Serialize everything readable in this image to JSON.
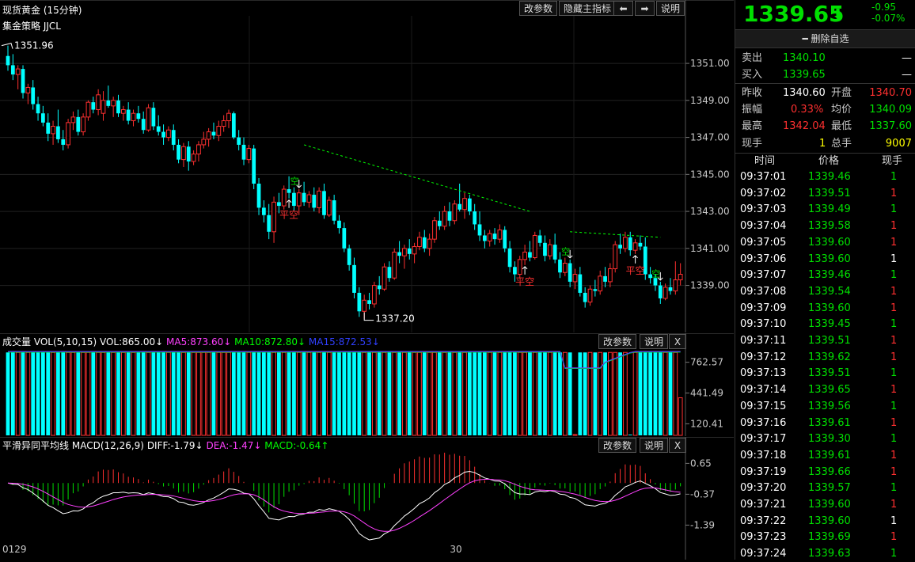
{
  "header": {
    "title": "现货黄金 (15分钟)",
    "buttons": [
      "改参数",
      "隐藏主指标",
      "⬅",
      "➡",
      "说明"
    ]
  },
  "strategy_label": "集金策略 JJCL",
  "chart_data": [
    {
      "type": "candlestick",
      "title": "现货黄金 (15分钟)",
      "y_ticks": [
        "1351.00",
        "1349.00",
        "1347.00",
        "1345.00",
        "1343.00",
        "1341.00",
        "1339.00"
      ],
      "ylim": [
        1336.8,
        1352.8
      ],
      "x_labels": [
        {
          "index": 0,
          "text": "0129"
        },
        {
          "index": 89,
          "text": "30"
        }
      ],
      "annotations": {
        "high_label": "1351.96",
        "low_label": "1337.20"
      },
      "signals": [
        {
          "i": 58,
          "kind": "空"
        },
        {
          "i": 56,
          "kind": "平空"
        },
        {
          "i": 112,
          "kind": "空"
        },
        {
          "i": 103,
          "kind": "平空"
        },
        {
          "i": 130,
          "kind": "空"
        },
        {
          "i": 125,
          "kind": "平空"
        }
      ],
      "candles": [
        [
          1351.4,
          1351.96,
          1350.6,
          1350.9
        ],
        [
          1350.9,
          1351.5,
          1350.1,
          1350.4
        ],
        [
          1350.4,
          1350.9,
          1349.6,
          1350.7
        ],
        [
          1350.7,
          1350.9,
          1349.1,
          1349.4
        ],
        [
          1349.4,
          1349.9,
          1348.8,
          1349.7
        ],
        [
          1349.7,
          1350.1,
          1348.5,
          1348.8
        ],
        [
          1348.8,
          1349.2,
          1347.9,
          1348.3
        ],
        [
          1348.3,
          1348.7,
          1347.6,
          1347.8
        ],
        [
          1347.8,
          1348.3,
          1346.8,
          1347.2
        ],
        [
          1347.2,
          1347.9,
          1346.6,
          1347.6
        ],
        [
          1347.6,
          1348.5,
          1346.7,
          1346.9
        ],
        [
          1346.9,
          1347.4,
          1346.3,
          1346.6
        ],
        [
          1346.6,
          1348.0,
          1346.4,
          1347.8
        ],
        [
          1347.8,
          1348.4,
          1347.4,
          1348.1
        ],
        [
          1348.1,
          1348.5,
          1347.1,
          1347.3
        ],
        [
          1347.3,
          1348.3,
          1347.1,
          1348.1
        ],
        [
          1348.1,
          1349.0,
          1347.9,
          1348.9
        ],
        [
          1348.9,
          1349.2,
          1348.3,
          1348.5
        ],
        [
          1348.5,
          1349.6,
          1348.2,
          1349.3
        ],
        [
          1348.3,
          1349.5,
          1347.9,
          1349.0
        ],
        [
          1349.0,
          1349.8,
          1348.6,
          1348.7
        ],
        [
          1348.7,
          1349.2,
          1348.1,
          1349.0
        ],
        [
          1349.0,
          1349.3,
          1348.1,
          1348.3
        ],
        [
          1348.3,
          1348.7,
          1347.9,
          1348.5
        ],
        [
          1348.5,
          1348.9,
          1347.7,
          1347.9
        ],
        [
          1347.9,
          1348.5,
          1347.6,
          1348.3
        ],
        [
          1348.3,
          1348.7,
          1347.8,
          1348.0
        ],
        [
          1348.0,
          1348.4,
          1347.2,
          1347.4
        ],
        [
          1347.4,
          1348.8,
          1347.3,
          1348.6
        ],
        [
          1348.6,
          1348.9,
          1347.4,
          1347.6
        ],
        [
          1347.6,
          1348.2,
          1347.1,
          1347.3
        ],
        [
          1347.3,
          1347.7,
          1346.6,
          1347.0
        ],
        [
          1347.0,
          1347.6,
          1346.8,
          1347.4
        ],
        [
          1347.4,
          1347.7,
          1346.3,
          1346.6
        ],
        [
          1346.6,
          1346.9,
          1345.6,
          1345.8
        ],
        [
          1345.8,
          1346.7,
          1345.4,
          1346.5
        ],
        [
          1346.5,
          1346.8,
          1345.2,
          1345.7
        ],
        [
          1345.7,
          1346.3,
          1345.5,
          1346.1
        ],
        [
          1346.1,
          1346.8,
          1345.7,
          1346.6
        ],
        [
          1346.6,
          1347.3,
          1346.4,
          1346.9
        ],
        [
          1346.9,
          1347.5,
          1346.5,
          1347.3
        ],
        [
          1347.3,
          1347.8,
          1346.9,
          1347.1
        ],
        [
          1347.1,
          1347.9,
          1346.8,
          1347.6
        ],
        [
          1347.6,
          1348.2,
          1347.3,
          1347.9
        ],
        [
          1347.9,
          1348.5,
          1347.5,
          1348.3
        ],
        [
          1348.3,
          1348.4,
          1346.9,
          1347.0
        ],
        [
          1347.0,
          1347.4,
          1346.3,
          1346.6
        ],
        [
          1346.6,
          1347.0,
          1345.5,
          1345.8
        ],
        [
          1345.8,
          1346.6,
          1345.6,
          1346.4
        ],
        [
          1346.4,
          1346.6,
          1344.2,
          1344.5
        ],
        [
          1344.5,
          1344.8,
          1342.8,
          1343.2
        ],
        [
          1343.2,
          1343.6,
          1342.4,
          1342.8
        ],
        [
          1342.8,
          1343.4,
          1341.5,
          1341.9
        ],
        [
          1341.9,
          1343.8,
          1341.3,
          1343.5
        ],
        [
          1343.5,
          1344.0,
          1342.9,
          1343.3
        ],
        [
          1343.3,
          1344.4,
          1343.1,
          1344.2
        ],
        [
          1344.2,
          1344.9,
          1343.7,
          1344.0
        ],
        [
          1344.0,
          1344.3,
          1343.0,
          1343.3
        ],
        [
          1343.3,
          1344.2,
          1342.8,
          1344.0
        ],
        [
          1344.0,
          1344.6,
          1343.3,
          1343.5
        ],
        [
          1343.5,
          1344.1,
          1343.2,
          1343.9
        ],
        [
          1343.9,
          1344.3,
          1343.0,
          1343.2
        ],
        [
          1343.2,
          1344.3,
          1342.9,
          1344.1
        ],
        [
          1344.1,
          1344.5,
          1342.6,
          1342.8
        ],
        [
          1342.8,
          1343.8,
          1342.7,
          1343.6
        ],
        [
          1343.6,
          1343.9,
          1342.3,
          1342.5
        ],
        [
          1342.5,
          1342.8,
          1341.8,
          1342.1
        ],
        [
          1342.1,
          1342.4,
          1340.8,
          1341.0
        ],
        [
          1341.0,
          1341.2,
          1339.8,
          1340.1
        ],
        [
          1340.1,
          1340.5,
          1338.3,
          1338.6
        ],
        [
          1338.6,
          1338.9,
          1337.3,
          1337.6
        ],
        [
          1337.6,
          1338.5,
          1337.2,
          1338.2
        ],
        [
          1338.2,
          1338.6,
          1337.7,
          1338.0
        ],
        [
          1338.0,
          1339.2,
          1337.8,
          1339.0
        ],
        [
          1339.0,
          1339.5,
          1338.5,
          1338.8
        ],
        [
          1338.8,
          1340.2,
          1338.7,
          1340.0
        ],
        [
          1340.0,
          1340.3,
          1339.2,
          1339.4
        ],
        [
          1339.4,
          1341.0,
          1339.3,
          1340.8
        ],
        [
          1340.8,
          1341.4,
          1340.2,
          1340.6
        ],
        [
          1340.6,
          1341.2,
          1339.9,
          1341.0
        ],
        [
          1341.0,
          1341.5,
          1340.4,
          1340.7
        ],
        [
          1340.7,
          1341.3,
          1340.2,
          1341.1
        ],
        [
          1341.1,
          1341.9,
          1340.9,
          1341.6
        ],
        [
          1341.6,
          1342.0,
          1340.8,
          1341.0
        ],
        [
          1341.0,
          1341.8,
          1340.6,
          1341.5
        ],
        [
          1341.5,
          1342.7,
          1341.3,
          1342.5
        ],
        [
          1342.5,
          1343.0,
          1342.0,
          1342.2
        ],
        [
          1342.2,
          1343.3,
          1342.0,
          1343.0
        ],
        [
          1343.0,
          1343.5,
          1342.2,
          1342.5
        ],
        [
          1342.5,
          1343.6,
          1342.3,
          1343.4
        ],
        [
          1343.4,
          1344.5,
          1343.0,
          1343.1
        ],
        [
          1343.1,
          1344.0,
          1342.6,
          1343.7
        ],
        [
          1343.7,
          1343.9,
          1342.8,
          1343.0
        ],
        [
          1343.0,
          1343.4,
          1342.0,
          1342.3
        ],
        [
          1342.3,
          1343.0,
          1341.4,
          1341.7
        ],
        [
          1341.7,
          1342.0,
          1341.0,
          1341.4
        ],
        [
          1341.4,
          1342.0,
          1341.1,
          1341.8
        ],
        [
          1341.8,
          1342.1,
          1341.2,
          1341.5
        ],
        [
          1341.5,
          1342.3,
          1341.3,
          1342.0
        ],
        [
          1342.0,
          1342.2,
          1340.8,
          1341.0
        ],
        [
          1341.0,
          1341.4,
          1339.7,
          1340.0
        ],
        [
          1340.0,
          1340.3,
          1339.2,
          1339.6
        ],
        [
          1339.6,
          1340.6,
          1339.4,
          1340.4
        ],
        [
          1340.4,
          1341.2,
          1340.1,
          1340.8
        ],
        [
          1340.8,
          1341.4,
          1340.3,
          1340.5
        ],
        [
          1340.5,
          1341.9,
          1340.4,
          1341.7
        ],
        [
          1341.7,
          1342.0,
          1341.1,
          1341.3
        ],
        [
          1341.3,
          1341.7,
          1340.3,
          1340.6
        ],
        [
          1340.6,
          1341.5,
          1340.4,
          1341.2
        ],
        [
          1341.2,
          1341.8,
          1340.2,
          1340.4
        ],
        [
          1340.4,
          1340.8,
          1339.4,
          1339.7
        ],
        [
          1339.7,
          1340.5,
          1339.5,
          1340.2
        ],
        [
          1340.2,
          1340.4,
          1338.9,
          1339.2
        ],
        [
          1339.2,
          1339.9,
          1338.8,
          1339.6
        ],
        [
          1339.6,
          1340.0,
          1338.4,
          1338.6
        ],
        [
          1338.6,
          1338.9,
          1337.8,
          1338.1
        ],
        [
          1338.1,
          1339.0,
          1337.9,
          1338.8
        ],
        [
          1338.8,
          1339.3,
          1338.4,
          1338.7
        ],
        [
          1338.7,
          1339.8,
          1338.5,
          1339.5
        ],
        [
          1339.5,
          1340.0,
          1338.9,
          1339.2
        ],
        [
          1339.2,
          1340.2,
          1338.9,
          1339.9
        ],
        [
          1339.9,
          1341.4,
          1339.7,
          1341.2
        ],
        [
          1341.2,
          1341.8,
          1340.7,
          1341.0
        ],
        [
          1341.0,
          1341.9,
          1340.8,
          1341.6
        ],
        [
          1341.6,
          1341.9,
          1340.6,
          1340.9
        ],
        [
          1340.9,
          1341.5,
          1340.7,
          1341.3
        ],
        [
          1341.3,
          1341.7,
          1340.9,
          1341.1
        ],
        [
          1341.1,
          1341.6,
          1339.3,
          1339.6
        ],
        [
          1339.6,
          1340.0,
          1339.1,
          1339.4
        ],
        [
          1339.4,
          1339.6,
          1338.7,
          1339.0
        ],
        [
          1339.0,
          1339.2,
          1338.0,
          1338.3
        ],
        [
          1338.3,
          1339.1,
          1338.2,
          1338.9
        ],
        [
          1338.9,
          1339.4,
          1338.5,
          1338.7
        ],
        [
          1338.7,
          1340.3,
          1338.5,
          1339.3
        ],
        [
          1339.3,
          1340.2,
          1339.0,
          1339.6
        ]
      ]
    },
    {
      "type": "bar",
      "title": "成交量",
      "indicator": "VOL(5,10,15)",
      "legend": [
        {
          "label": "VOL:865.00↓",
          "color": "#ffffff"
        },
        {
          "label": "MA5:873.60↓",
          "color": "#ff40ff"
        },
        {
          "label": "MA10:872.80↓",
          "color": "#00ff00"
        },
        {
          "label": "MA15:872.53↓",
          "color": "#3040ff"
        }
      ],
      "y_ticks": [
        "762.57",
        "441.49",
        "120.41"
      ],
      "ylim": [
        0,
        900
      ]
    },
    {
      "type": "macd",
      "title": "平滑异同平均线",
      "indicator": "MACD(12,26,9)",
      "legend": [
        {
          "label": "DIFF:-1.79↓",
          "color": "#ffffff"
        },
        {
          "label": "DEA:-1.47↓",
          "color": "#ff40ff"
        },
        {
          "label": "MACD:-0.64↑",
          "color": "#00ff00"
        }
      ],
      "y_ticks": [
        "0.65",
        "-0.37",
        "-1.39"
      ],
      "ylim": [
        -2.4,
        1.0
      ]
    }
  ],
  "volume_panel": {
    "buttons": [
      "改参数",
      "说明",
      "X"
    ]
  },
  "macd_panel": {
    "buttons": [
      "改参数",
      "说明",
      "X"
    ]
  },
  "quote": {
    "price": "1339.65",
    "arrow": "⬇",
    "change": "-0.95",
    "change_pct": "-0.07%",
    "delete_label": "━ 删除自选",
    "sell_label": "卖出",
    "sell_value": "1340.10",
    "sell_dash": "—",
    "buy_label": "买入",
    "buy_value": "1339.65",
    "buy_dash": "—",
    "prev_close_label": "昨收",
    "prev_close": "1340.60",
    "open_label": "开盘",
    "open": "1340.70",
    "amplitude_label": "振幅",
    "amplitude": "0.33%",
    "avg_label": "均价",
    "avg": "1340.09",
    "high_label": "最高",
    "high": "1342.04",
    "low_label": "最低",
    "low": "1337.60",
    "hand_label": "现手",
    "hand": "1",
    "total_label": "总手",
    "total": "9007"
  },
  "trades": {
    "headers": [
      "时间",
      "价格",
      "现手"
    ],
    "rows": [
      [
        "09:37:01",
        "1339.46",
        "1",
        "g"
      ],
      [
        "09:37:02",
        "1339.51",
        "1",
        "r"
      ],
      [
        "09:37:03",
        "1339.49",
        "1",
        "g"
      ],
      [
        "09:37:04",
        "1339.58",
        "1",
        "r"
      ],
      [
        "09:37:05",
        "1339.60",
        "1",
        "r"
      ],
      [
        "09:37:06",
        "1339.60",
        "1",
        "w"
      ],
      [
        "09:37:07",
        "1339.46",
        "1",
        "g"
      ],
      [
        "09:37:08",
        "1339.54",
        "1",
        "r"
      ],
      [
        "09:37:09",
        "1339.60",
        "1",
        "r"
      ],
      [
        "09:37:10",
        "1339.45",
        "1",
        "g"
      ],
      [
        "09:37:11",
        "1339.51",
        "1",
        "r"
      ],
      [
        "09:37:12",
        "1339.62",
        "1",
        "r"
      ],
      [
        "09:37:13",
        "1339.51",
        "1",
        "g"
      ],
      [
        "09:37:14",
        "1339.65",
        "1",
        "r"
      ],
      [
        "09:37:15",
        "1339.56",
        "1",
        "g"
      ],
      [
        "09:37:16",
        "1339.61",
        "1",
        "r"
      ],
      [
        "09:37:17",
        "1339.30",
        "1",
        "g"
      ],
      [
        "09:37:18",
        "1339.61",
        "1",
        "r"
      ],
      [
        "09:37:19",
        "1339.66",
        "1",
        "r"
      ],
      [
        "09:37:20",
        "1339.57",
        "1",
        "g"
      ],
      [
        "09:37:21",
        "1339.60",
        "1",
        "r"
      ],
      [
        "09:37:22",
        "1339.60",
        "1",
        "w"
      ],
      [
        "09:37:23",
        "1339.69",
        "1",
        "r"
      ],
      [
        "09:37:24",
        "1339.63",
        "1",
        "g"
      ]
    ]
  },
  "colors": {
    "up": "#ff3030",
    "down": "#00ffff",
    "text_green": "#00e000",
    "text_red": "#ff3030",
    "text_yellow": "#ffff00"
  }
}
